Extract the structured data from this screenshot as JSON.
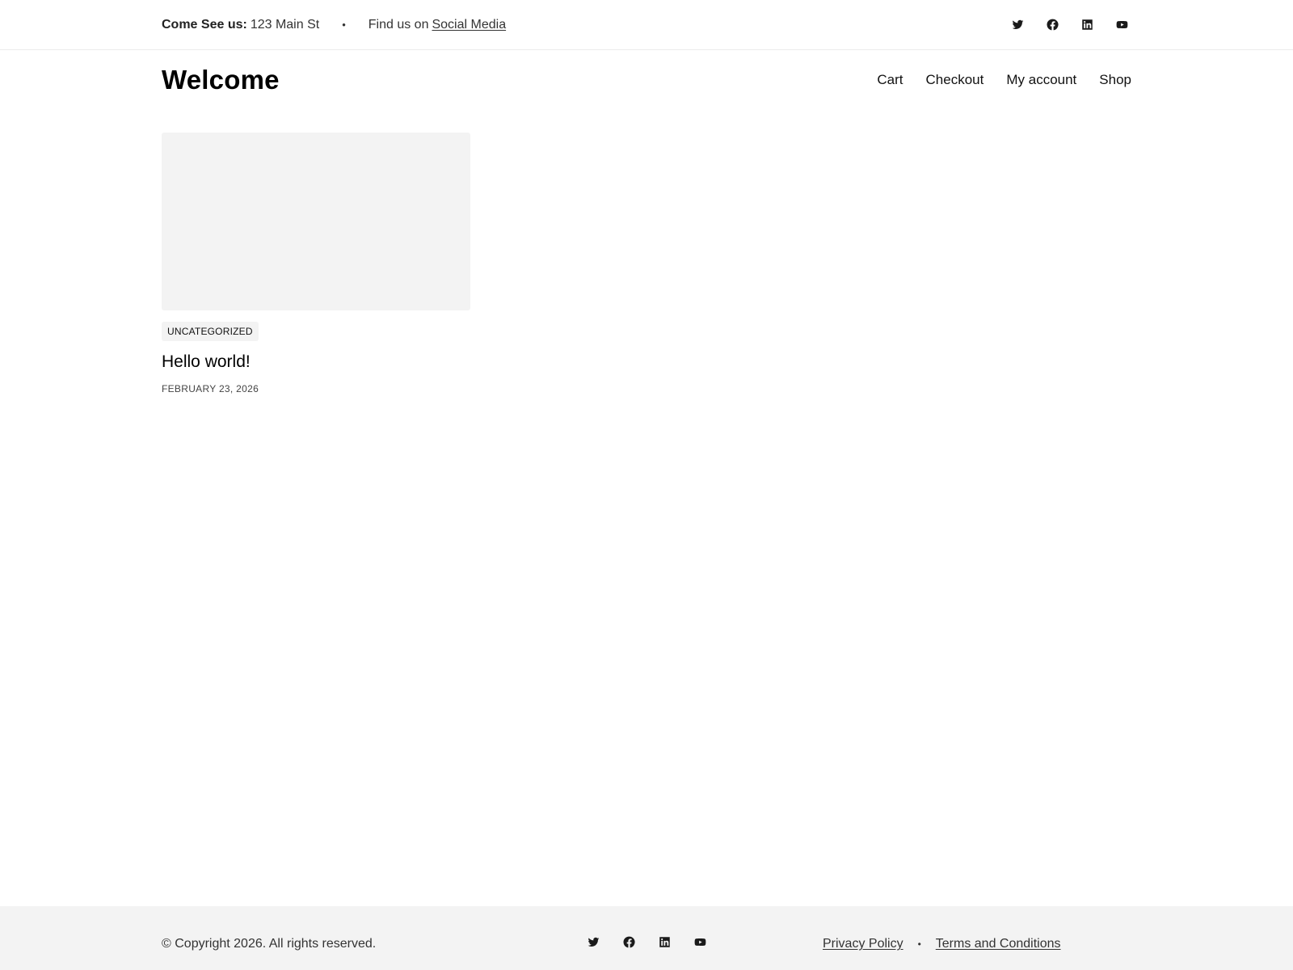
{
  "topbar": {
    "address_label": "Come See us:",
    "address_value": "123 Main St",
    "separator": "•",
    "find_us_text": "Find us on",
    "social_link": "Social Media",
    "social_icons": [
      "twitter-icon",
      "facebook-icon",
      "linkedin-icon",
      "youtube-icon"
    ]
  },
  "header": {
    "site_title": "Welcome",
    "nav": [
      {
        "label": "Cart"
      },
      {
        "label": "Checkout"
      },
      {
        "label": "My account"
      },
      {
        "label": "Shop"
      }
    ]
  },
  "posts": [
    {
      "category": "UNCATEGORIZED",
      "title": "Hello world!",
      "date": "FEBRUARY 23, 2026"
    }
  ],
  "footer": {
    "copyright": "© Copyright 2026. All rights reserved.",
    "social_icons": [
      "twitter-icon",
      "facebook-icon",
      "linkedin-icon",
      "youtube-icon"
    ],
    "links": [
      {
        "label": "Privacy Policy"
      },
      {
        "label": "Terms and Conditions"
      }
    ],
    "separator": "•"
  },
  "colors": {
    "background": "#ffffff",
    "footer_background": "#f3f3f3",
    "thumbnail_placeholder": "#f3f3f3",
    "text": "#111111"
  }
}
